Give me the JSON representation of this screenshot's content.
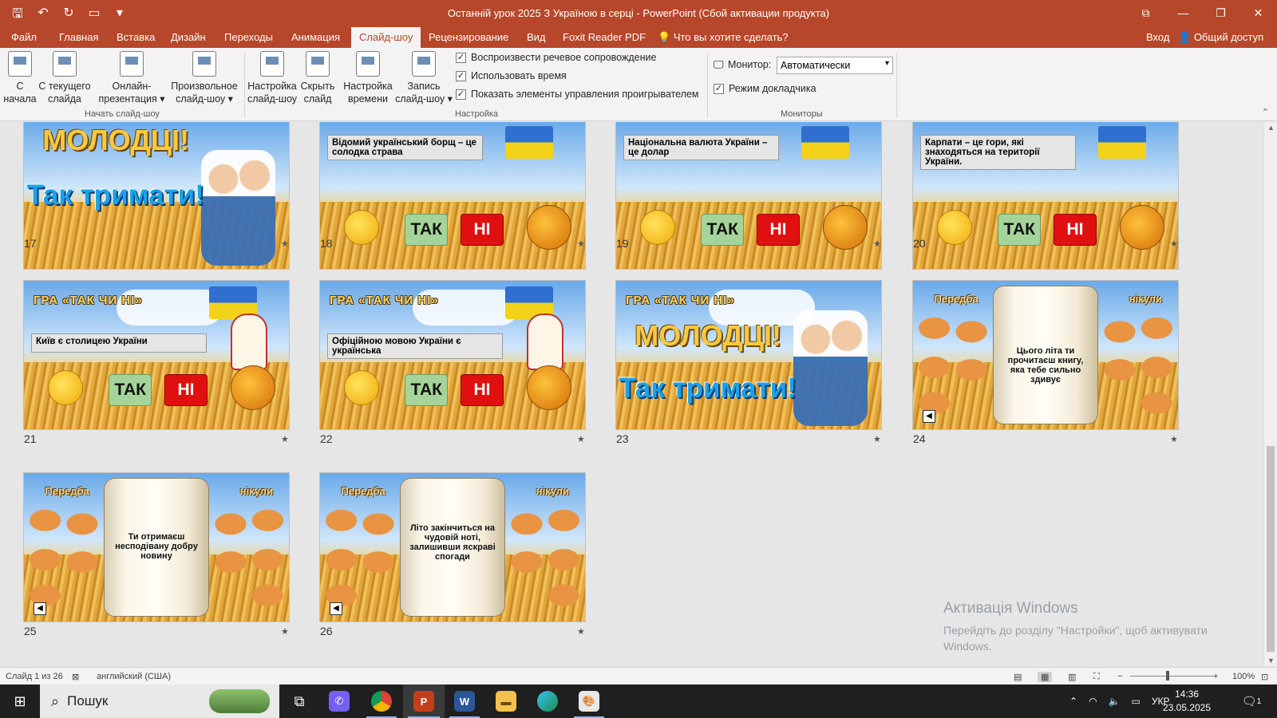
{
  "window": {
    "title": "Останній урок 2025 З Україною в серці - PowerPoint (Сбой активации продукта)",
    "accent": "#b7472a"
  },
  "qat": {
    "save": "save-icon",
    "undo": "undo-icon",
    "redo": "redo-icon",
    "present": "present-icon",
    "more": "▾"
  },
  "tabs": {
    "file": "Файл",
    "home": "Главная",
    "insert": "Вставка",
    "design": "Дизайн",
    "transitions": "Переходы",
    "animations": "Анимация",
    "slideshow": "Слайд-шоу",
    "review": "Рецензирование",
    "view": "Вид",
    "foxit": "Foxit Reader PDF",
    "tellme": "Что вы хотите сделать?",
    "signin": "Вход",
    "share": "Общий доступ"
  },
  "ribbon": {
    "start": {
      "from_start_1": "С",
      "from_start_2": "начала",
      "from_current_1": "С текущего",
      "from_current_2": "слайда",
      "online_1": "Онлайн-",
      "online_2": "презентация",
      "custom_1": "Произвольное",
      "custom_2": "слайд-шоу",
      "group": "Начать слайд-шоу"
    },
    "setup": {
      "setup_1": "Настройка",
      "setup_2": "слайд-шоу",
      "hide_1": "Скрыть",
      "hide_2": "слайд",
      "rehearse_1": "Настройка",
      "rehearse_2": "времени",
      "record_1": "Запись",
      "record_2": "слайд-шоу",
      "narration": "Воспроизвести речевое сопровождение",
      "timings": "Использовать время",
      "controls": "Показать элементы управления проигрывателем",
      "group": "Настройка"
    },
    "monitors": {
      "monitor_label": "Монитор:",
      "monitor_value": "Автоматически",
      "presenter": "Режим докладчика",
      "group": "Мониторы"
    }
  },
  "slides": [
    {
      "num": "17",
      "heading": "МОЛОДЦІ!",
      "subheading": "Так тримати!"
    },
    {
      "num": "18",
      "question": "Відомий український борщ – це солодка страва",
      "yes": "ТАК",
      "no": "НІ"
    },
    {
      "num": "19",
      "question": "Національна валюта України – це долар",
      "yes": "ТАК",
      "no": "НІ"
    },
    {
      "num": "20",
      "question": "Карпати – це гори, які знаходяться на території України.",
      "yes": "ТАК",
      "no": "НІ"
    },
    {
      "num": "21",
      "game": "ГРА «ТАК ЧИ НІ»",
      "question": "Київ є столицею України",
      "yes": "ТАК",
      "no": "НІ"
    },
    {
      "num": "22",
      "game": "ГРА «ТАК ЧИ НІ»",
      "question": "Офіційною мовою України є українська",
      "yes": "ТАК",
      "no": "НІ"
    },
    {
      "num": "23",
      "game": "ГРА «ТАК ЧИ НІ»",
      "heading": "МОЛОДЦІ!",
      "subheading": "Так тримати!"
    },
    {
      "num": "24",
      "predict_left": "Передба",
      "predict_right": "нікули",
      "scroll": "Цього літа ти прочитаєш книгу, яка тебе сильно здивує"
    },
    {
      "num": "25",
      "predict_left": "Передба",
      "predict_right": "нікули",
      "scroll": "Ти отримаєш несподівану добру новину"
    },
    {
      "num": "26",
      "predict_left": "Передба",
      "predict_right": "нікули",
      "scroll": "Літо закінчиться на чудовій ноті, залишивши яскраві спогади"
    }
  ],
  "slide_star": "★",
  "watermark": {
    "title": "Активація Windows",
    "text": "Перейдіть до розділу \"Настройки\", щоб активувати Windows."
  },
  "status": {
    "slide": "Слайд 1 из 26",
    "lang": "английский (США)",
    "zoom": "100%"
  },
  "taskbar": {
    "search": "Пошук",
    "lang": "УКР",
    "time": "14:36",
    "date": "23.05.2025",
    "notif": "1"
  }
}
